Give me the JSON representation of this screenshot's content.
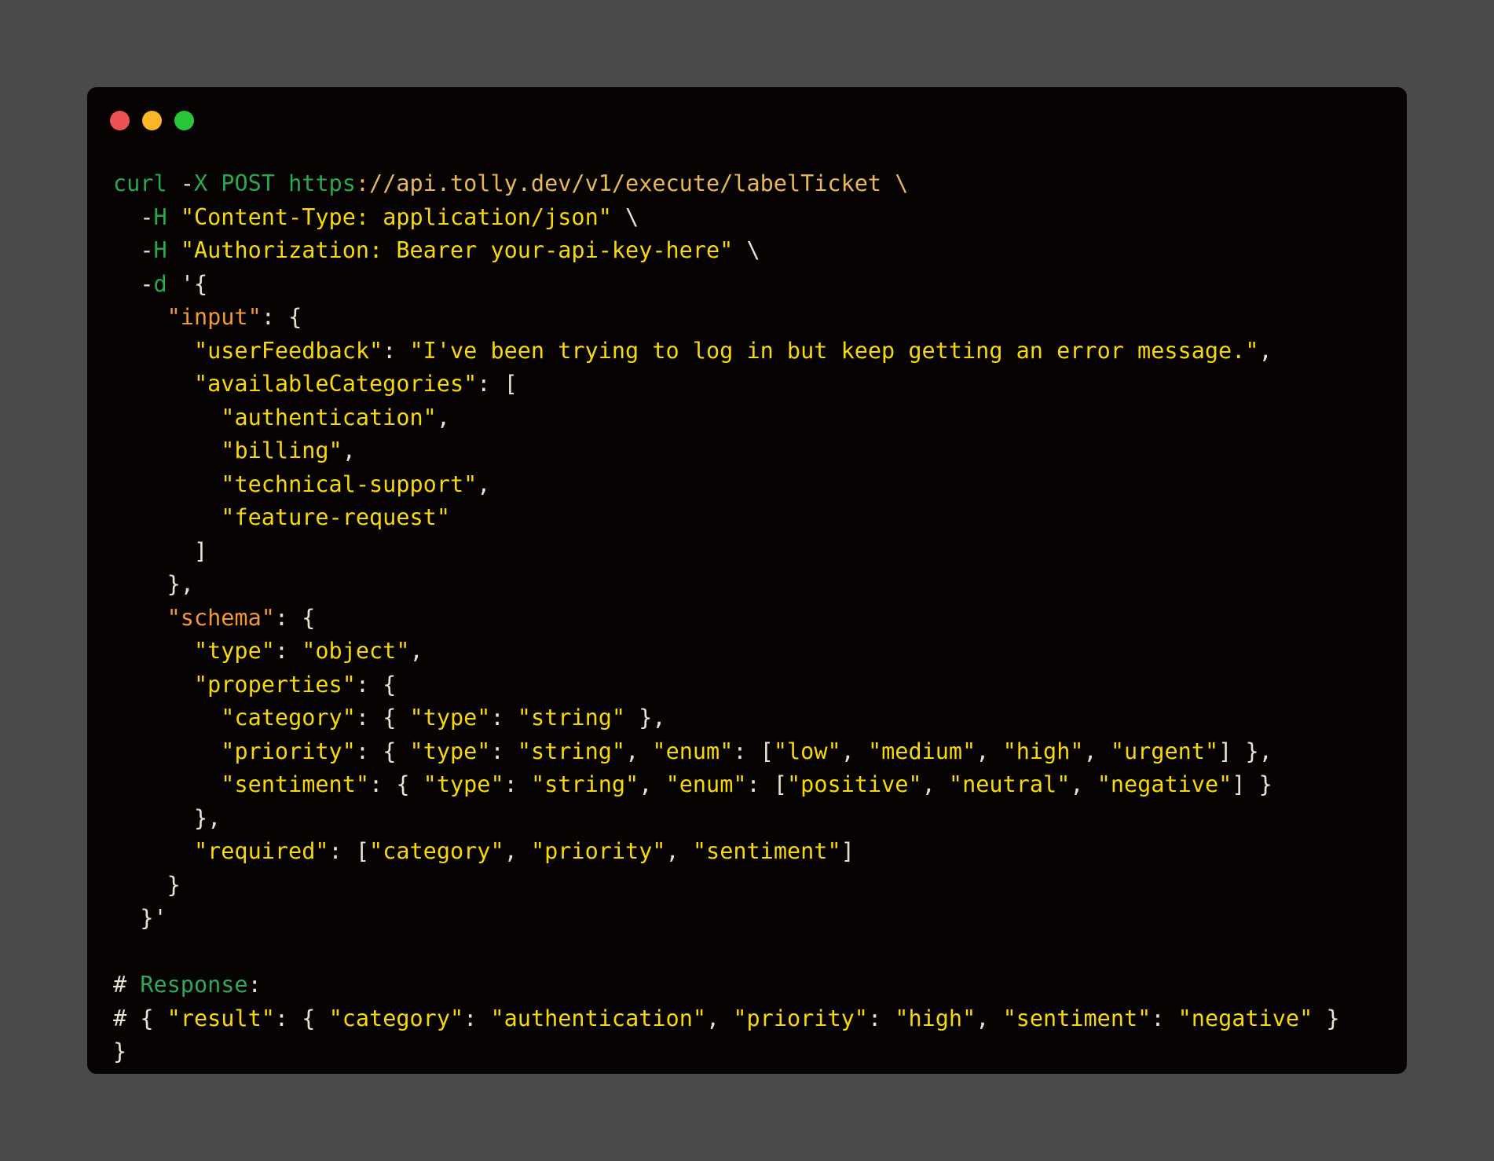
{
  "window": {
    "controls": [
      {
        "name": "close",
        "color": "#ee5351"
      },
      {
        "name": "minimize",
        "color": "#fab627"
      },
      {
        "name": "maximize",
        "color": "#26c53c"
      }
    ]
  },
  "code": {
    "lines": [
      [
        {
          "t": "curl ",
          "c": "cmd"
        },
        {
          "t": "-",
          "c": "pun"
        },
        {
          "t": "X POST ",
          "c": "cmd"
        },
        {
          "t": "https",
          "c": "cmd"
        },
        {
          "t": "://api.tolly.dev/v1/execute/labelTicket \\",
          "c": "url"
        }
      ],
      [
        {
          "t": "  -",
          "c": "pun"
        },
        {
          "t": "H ",
          "c": "cmd"
        },
        {
          "t": "\"Content-Type: application/json\"",
          "c": "str"
        },
        {
          "t": " \\",
          "c": "pun"
        }
      ],
      [
        {
          "t": "  -",
          "c": "pun"
        },
        {
          "t": "H ",
          "c": "cmd"
        },
        {
          "t": "\"Authorization: Bearer your-api-key-here\"",
          "c": "str"
        },
        {
          "t": " \\",
          "c": "pun"
        }
      ],
      [
        {
          "t": "  -",
          "c": "pun"
        },
        {
          "t": "d ",
          "c": "cmd"
        },
        {
          "t": "'{",
          "c": "pun"
        }
      ],
      [
        {
          "t": "    ",
          "c": "pun"
        },
        {
          "t": "\"input\"",
          "c": "key"
        },
        {
          "t": ": {",
          "c": "pun"
        }
      ],
      [
        {
          "t": "      ",
          "c": "pun"
        },
        {
          "t": "\"userFeedback\"",
          "c": "str"
        },
        {
          "t": ": ",
          "c": "pun"
        },
        {
          "t": "\"I've been trying to log in but keep getting an error message.\"",
          "c": "str"
        },
        {
          "t": ",",
          "c": "pun"
        }
      ],
      [
        {
          "t": "      ",
          "c": "pun"
        },
        {
          "t": "\"availableCategories\"",
          "c": "str"
        },
        {
          "t": ": [",
          "c": "pun"
        }
      ],
      [
        {
          "t": "        ",
          "c": "pun"
        },
        {
          "t": "\"authentication\"",
          "c": "str"
        },
        {
          "t": ",",
          "c": "pun"
        }
      ],
      [
        {
          "t": "        ",
          "c": "pun"
        },
        {
          "t": "\"billing\"",
          "c": "str"
        },
        {
          "t": ",",
          "c": "pun"
        }
      ],
      [
        {
          "t": "        ",
          "c": "pun"
        },
        {
          "t": "\"technical-support\"",
          "c": "str"
        },
        {
          "t": ",",
          "c": "pun"
        }
      ],
      [
        {
          "t": "        ",
          "c": "pun"
        },
        {
          "t": "\"feature-request\"",
          "c": "str"
        }
      ],
      [
        {
          "t": "      ]",
          "c": "pun"
        }
      ],
      [
        {
          "t": "    },",
          "c": "pun"
        }
      ],
      [
        {
          "t": "    ",
          "c": "pun"
        },
        {
          "t": "\"schema\"",
          "c": "key"
        },
        {
          "t": ": {",
          "c": "pun"
        }
      ],
      [
        {
          "t": "      ",
          "c": "pun"
        },
        {
          "t": "\"type\"",
          "c": "str"
        },
        {
          "t": ": ",
          "c": "pun"
        },
        {
          "t": "\"object\"",
          "c": "str"
        },
        {
          "t": ",",
          "c": "pun"
        }
      ],
      [
        {
          "t": "      ",
          "c": "pun"
        },
        {
          "t": "\"properties\"",
          "c": "str"
        },
        {
          "t": ": {",
          "c": "pun"
        }
      ],
      [
        {
          "t": "        ",
          "c": "pun"
        },
        {
          "t": "\"category\"",
          "c": "str"
        },
        {
          "t": ": { ",
          "c": "pun"
        },
        {
          "t": "\"type\"",
          "c": "str"
        },
        {
          "t": ": ",
          "c": "pun"
        },
        {
          "t": "\"string\"",
          "c": "str"
        },
        {
          "t": " },",
          "c": "pun"
        }
      ],
      [
        {
          "t": "        ",
          "c": "pun"
        },
        {
          "t": "\"priority\"",
          "c": "str"
        },
        {
          "t": ": { ",
          "c": "pun"
        },
        {
          "t": "\"type\"",
          "c": "str"
        },
        {
          "t": ": ",
          "c": "pun"
        },
        {
          "t": "\"string\"",
          "c": "str"
        },
        {
          "t": ", ",
          "c": "pun"
        },
        {
          "t": "\"enum\"",
          "c": "str"
        },
        {
          "t": ": [",
          "c": "pun"
        },
        {
          "t": "\"low\"",
          "c": "str"
        },
        {
          "t": ", ",
          "c": "pun"
        },
        {
          "t": "\"medium\"",
          "c": "str"
        },
        {
          "t": ", ",
          "c": "pun"
        },
        {
          "t": "\"high\"",
          "c": "str"
        },
        {
          "t": ", ",
          "c": "pun"
        },
        {
          "t": "\"urgent\"",
          "c": "str"
        },
        {
          "t": "] },",
          "c": "pun"
        }
      ],
      [
        {
          "t": "        ",
          "c": "pun"
        },
        {
          "t": "\"sentiment\"",
          "c": "str"
        },
        {
          "t": ": { ",
          "c": "pun"
        },
        {
          "t": "\"type\"",
          "c": "str"
        },
        {
          "t": ": ",
          "c": "pun"
        },
        {
          "t": "\"string\"",
          "c": "str"
        },
        {
          "t": ", ",
          "c": "pun"
        },
        {
          "t": "\"enum\"",
          "c": "str"
        },
        {
          "t": ": [",
          "c": "pun"
        },
        {
          "t": "\"positive\"",
          "c": "str"
        },
        {
          "t": ", ",
          "c": "pun"
        },
        {
          "t": "\"neutral\"",
          "c": "str"
        },
        {
          "t": ", ",
          "c": "pun"
        },
        {
          "t": "\"negative\"",
          "c": "str"
        },
        {
          "t": "] }",
          "c": "pun"
        }
      ],
      [
        {
          "t": "      },",
          "c": "pun"
        }
      ],
      [
        {
          "t": "      ",
          "c": "pun"
        },
        {
          "t": "\"required\"",
          "c": "str"
        },
        {
          "t": ": [",
          "c": "pun"
        },
        {
          "t": "\"category\"",
          "c": "str"
        },
        {
          "t": ", ",
          "c": "pun"
        },
        {
          "t": "\"priority\"",
          "c": "str"
        },
        {
          "t": ", ",
          "c": "pun"
        },
        {
          "t": "\"sentiment\"",
          "c": "str"
        },
        {
          "t": "]",
          "c": "pun"
        }
      ],
      [
        {
          "t": "    }",
          "c": "pun"
        }
      ],
      [
        {
          "t": "  }'",
          "c": "pun"
        }
      ],
      [
        {
          "t": "",
          "c": "pun"
        }
      ],
      [
        {
          "t": "# ",
          "c": "hash"
        },
        {
          "t": "Response",
          "c": "com"
        },
        {
          "t": ":",
          "c": "hash"
        }
      ],
      [
        {
          "t": "# { ",
          "c": "hash"
        },
        {
          "t": "\"result\"",
          "c": "str"
        },
        {
          "t": ": { ",
          "c": "pun"
        },
        {
          "t": "\"category\"",
          "c": "str"
        },
        {
          "t": ": ",
          "c": "pun"
        },
        {
          "t": "\"authentication\"",
          "c": "str"
        },
        {
          "t": ", ",
          "c": "pun"
        },
        {
          "t": "\"priority\"",
          "c": "str"
        },
        {
          "t": ": ",
          "c": "pun"
        },
        {
          "t": "\"high\"",
          "c": "str"
        },
        {
          "t": ", ",
          "c": "pun"
        },
        {
          "t": "\"sentiment\"",
          "c": "str"
        },
        {
          "t": ": ",
          "c": "pun"
        },
        {
          "t": "\"negative\"",
          "c": "str"
        },
        {
          "t": " }",
          "c": "pun"
        }
      ],
      [
        {
          "t": "}",
          "c": "pun"
        }
      ]
    ]
  }
}
